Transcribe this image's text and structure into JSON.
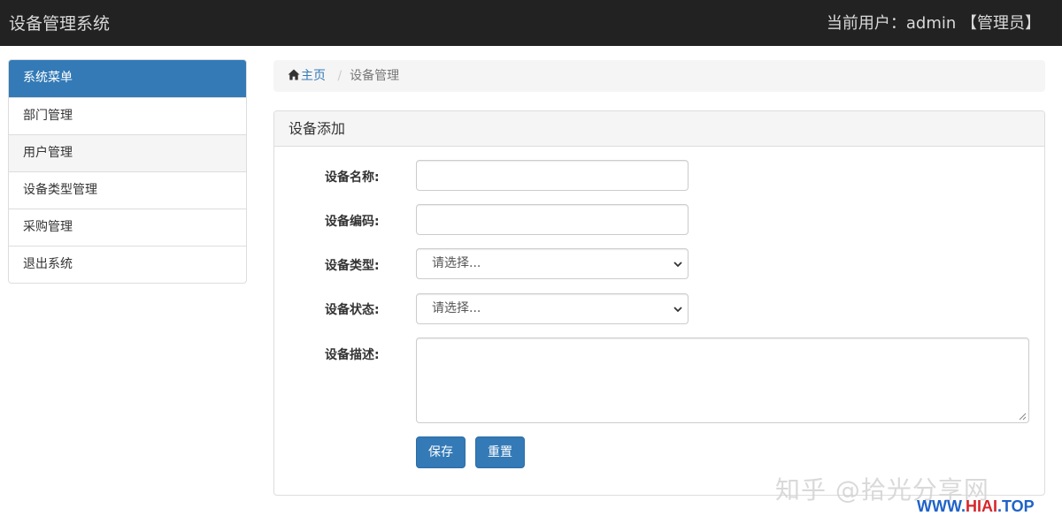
{
  "header": {
    "app_title": "设备管理系统",
    "current_user": "当前用户：admin 【管理员】"
  },
  "sidebar": {
    "title": "系统菜单",
    "items": [
      {
        "label": "部门管理"
      },
      {
        "label": "用户管理"
      },
      {
        "label": "设备类型管理"
      },
      {
        "label": "采购管理"
      },
      {
        "label": "退出系统"
      }
    ]
  },
  "breadcrumb": {
    "home": "主页",
    "separator": "/",
    "current": "设备管理"
  },
  "panel": {
    "title": "设备添加",
    "fields": {
      "name_label": "设备名称:",
      "name_value": "",
      "code_label": "设备编码:",
      "code_value": "",
      "type_label": "设备类型:",
      "type_selected": "请选择...",
      "status_label": "设备状态:",
      "status_selected": "请选择...",
      "desc_label": "设备描述:",
      "desc_value": ""
    },
    "buttons": {
      "save": "保存",
      "reset": "重置"
    }
  },
  "overlay": {
    "watermark": "知乎 @拾光分享网",
    "site_blue": "WWW.",
    "site_red": "HIAI",
    "site_tail": ".TOP"
  },
  "colors": {
    "navbar": "#222222",
    "primary": "#337ab7",
    "panel_heading": "#f5f5f5"
  }
}
